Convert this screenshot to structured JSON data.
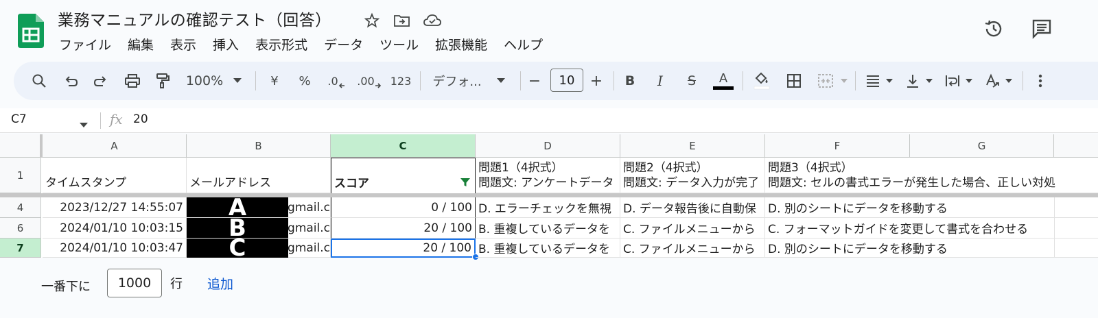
{
  "doc": {
    "title": "業務マニュアルの確認テスト（回答）"
  },
  "menu": [
    "ファイル",
    "編集",
    "表示",
    "挿入",
    "表示形式",
    "データ",
    "ツール",
    "拡張機能",
    "ヘルプ"
  ],
  "toolbar": {
    "zoom": "100%",
    "currency": "¥",
    "percent": "%",
    "dec_decrease": ".0",
    "dec_increase": ".00",
    "number_format": "123",
    "font": "デフォ...",
    "font_size": "10",
    "minus": "−",
    "plus": "+",
    "bold": "B",
    "italic": "I",
    "strike": "S",
    "text_color": "A",
    "accent_black": "#000000"
  },
  "formula": {
    "cell_ref": "C7",
    "fx": "fx",
    "value": "20"
  },
  "columns": [
    "A",
    "B",
    "C",
    "D",
    "E",
    "F",
    "G"
  ],
  "header_row": {
    "row_num": "1",
    "a": "タイムスタンプ",
    "b": "メールアドレス",
    "c": "スコア",
    "d1": "問題1（4択式）",
    "d2": "問題文: アンケートデータ",
    "e1": "問題2（4択式）",
    "e2": "問題文: データ入力が完了",
    "f1": "問題3（4択式）",
    "f2": "問題文: セルの書式エラーが発生した場合、正しい対処"
  },
  "rows": [
    {
      "num": "4",
      "a": "2023/12/27 14:55:07",
      "redact": "A",
      "b_tail": "@gmail.c",
      "c": "0 / 100",
      "d": "D. エラーチェックを無視",
      "e": "D. データ報告後に自動保",
      "f": "D. 別のシートにデータを移動する"
    },
    {
      "num": "6",
      "a": "2024/01/10 10:03:15",
      "redact": "B",
      "b_tail": "@gmail.c",
      "c": "20 / 100",
      "d": "B. 重複しているデータを",
      "e": "C. ファイルメニューから",
      "f": "C. フォーマットガイドを変更して書式を合わせる"
    },
    {
      "num": "7",
      "a": "2024/01/10 10:03:47",
      "redact": "C",
      "b_tail": "@gmail.c",
      "c": "20 / 100",
      "d": "B. 重複しているデータを",
      "e": "C. ファイルメニューから",
      "f": "D. 別のシートにデータを移動する"
    }
  ],
  "footer": {
    "prefix": "一番下に",
    "count": "1000",
    "unit": "行",
    "add": "追加"
  },
  "colors": {
    "selection_header": "#c4eed0",
    "selection_border": "#1a73e8",
    "filter_green": "#188038",
    "link_blue": "#0b57d0"
  },
  "icons": [
    "sheets-logo",
    "star-icon",
    "move-folder-icon",
    "cloud-status-icon",
    "history-icon",
    "comment-icon",
    "search-icon",
    "undo-icon",
    "redo-icon",
    "print-icon",
    "paint-format-icon",
    "fill-color-icon",
    "borders-icon",
    "merge-icon",
    "align-icon",
    "valign-icon",
    "wrap-icon",
    "rotate-icon",
    "more-icon",
    "filter-icon"
  ]
}
